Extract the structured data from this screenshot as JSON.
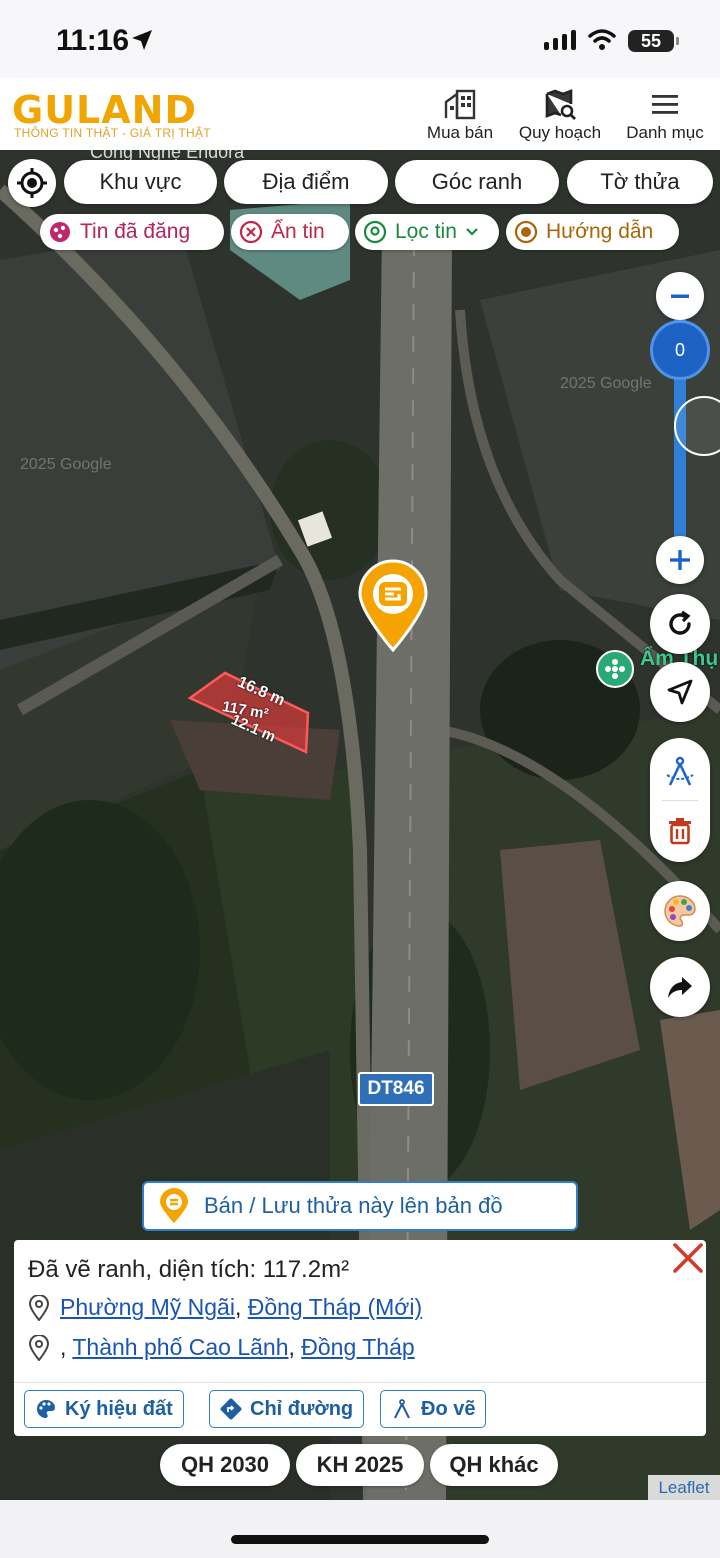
{
  "status_bar": {
    "time": "11:16",
    "battery": "55"
  },
  "header": {
    "logo_text": "GULAND",
    "tagline": "THÔNG TIN THẬT - GIÁ TRỊ THẬT",
    "nav": [
      {
        "label": "Mua bán",
        "icon": "building-icon"
      },
      {
        "label": "Quy hoạch",
        "icon": "map-search-icon"
      },
      {
        "label": "Danh mục",
        "icon": "menu-icon"
      }
    ]
  },
  "filters": {
    "primary": [
      "Khu vực",
      "Địa điểm",
      "Góc ranh",
      "Tờ thửa"
    ],
    "chips": [
      "Tin đã đăng",
      "Ẩn tin",
      "Lọc tin",
      "Hướng dẫn"
    ]
  },
  "map": {
    "poi_top": "Công Nghệ Endora",
    "poi_right": "Ẩm Thụ",
    "road_label": "DT846",
    "watermark": "2025 Google",
    "zoom_value": "0",
    "parcel": {
      "side_top": "16.8 m",
      "area": "117 m²",
      "side_bottom": "12.1 m"
    },
    "attribution": "Leaflet",
    "colors": {
      "accent": "#f0a500",
      "parcel": "#e53b3b",
      "zoom": "#1b64c8"
    }
  },
  "bottom": {
    "save_label": "Bán / Lưu thửa này lên bản đồ",
    "info": {
      "title": "Đã vẽ ranh, diện tích: 117.2m²",
      "line1": {
        "ward": "Phường Mỹ Ngãi",
        "province": "Đồng Tháp (Mới)"
      },
      "line2": {
        "prefix": ",",
        "city": "Thành phố Cao Lãnh",
        "province": "Đồng Tháp"
      }
    },
    "actions": [
      "Ký hiệu đất",
      "Chỉ đường",
      "Đo vẽ"
    ],
    "qh": [
      "QH 2030",
      "KH 2025",
      "QH khác"
    ]
  }
}
